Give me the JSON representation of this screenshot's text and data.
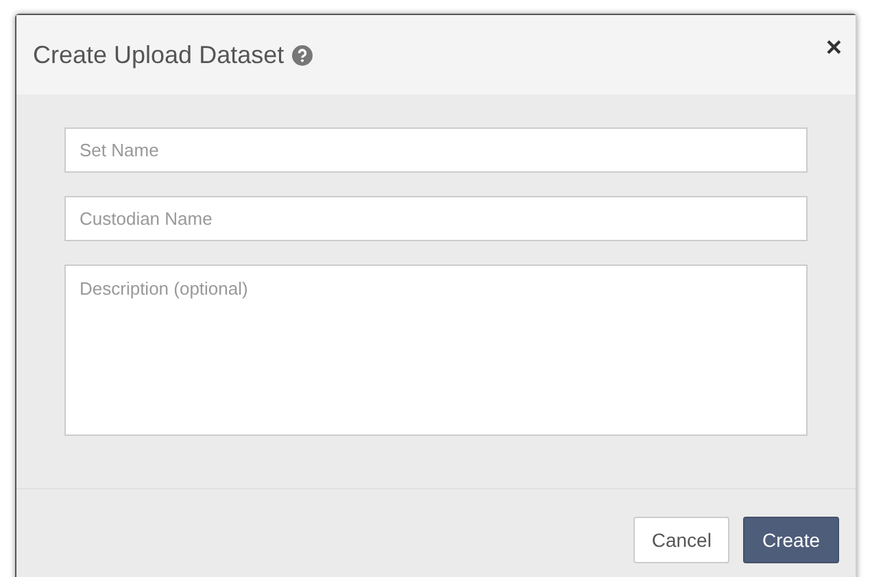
{
  "dialog": {
    "title": "Create Upload Dataset",
    "close": "×"
  },
  "fields": [
    {
      "kind": "input",
      "placeholder": "Set Name"
    },
    {
      "kind": "input",
      "placeholder": "Custodian Name"
    },
    {
      "kind": "textarea",
      "placeholder": "Description (optional)"
    }
  ],
  "buttons": [
    {
      "label": "Cancel",
      "kind": "default"
    },
    {
      "label": "Create",
      "kind": "primary"
    }
  ]
}
